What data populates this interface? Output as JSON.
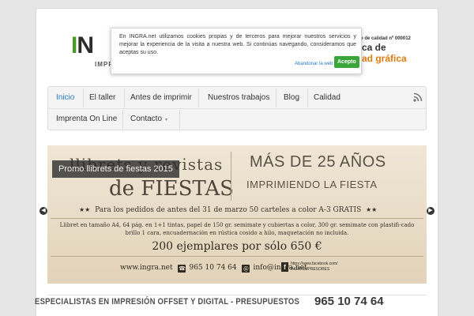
{
  "header": {
    "logo_text": "IN",
    "logo_sub": "IMPR",
    "cert": "o de calidad nº 000012",
    "tagline_1": "ca de",
    "tagline_2": "ad gráfica"
  },
  "nav": {
    "items": [
      {
        "label": "Inicio",
        "active": true
      },
      {
        "label": "El taller"
      },
      {
        "label": "Antes de imprimir"
      },
      {
        "label": "Nuestros trabajos"
      },
      {
        "label": "Blog"
      },
      {
        "label": "Calidad"
      },
      {
        "label": "Imprenta On Line"
      },
      {
        "label": "Contacto",
        "caret": "▾"
      }
    ],
    "rss_icon": "rss-icon"
  },
  "slider": {
    "caption": "Promo llibrets de fiestas 2015",
    "left_title": "llibrets y revistas",
    "left_title_2": "de FIESTAS",
    "right_title_1": "MÁS DE 25 AÑOS",
    "right_title_2": "IMPRIMIENDO LA FIESTA",
    "promo_line": "Para los pedidos de antes del 31 de marzo 50 carteles a color A-3 GRATIS",
    "description": "Llibret en tamaño A4, 64 pág. en 1+1 tintas, papel de 150 gr. semimate y  cubiertas a color, 300 gr. semimate con plastifi-cado brillo 1 cara, encuadernación en rústica cosido a hilo, maquetación no incluida.",
    "price": "200 ejemplares por sólo 650 €",
    "web": "www.ingra.net",
    "phone": "965 10 74 64",
    "email": "info@ingra.net",
    "facebook_url": "https://www.facebook.com/",
    "facebook_name": "INGRAIMPRESORES",
    "prev_icon": "chevron-left-icon",
    "next_icon": "chevron-right-icon"
  },
  "footer": {
    "text": "ESPECIALISTAS EN IMPRESIÓN OFFSET Y DIGITAL - PRESUPUESTOS",
    "phone": "965 10 74 64"
  },
  "cookie": {
    "text": "En INGRA.net utilizamos cookies propias y de terceros para mejorar nuestros servicios y mejorar la experiencia de la visita a nuestra web. Si continúas navegando, consideramos que aceptas su uso.",
    "leave_link": "Abandonar la web",
    "accept_button": "Acepto"
  },
  "colors": {
    "accent": "#2a7ac8",
    "accept_green": "#3aa63a",
    "tagline_orange": "#e07d10"
  }
}
